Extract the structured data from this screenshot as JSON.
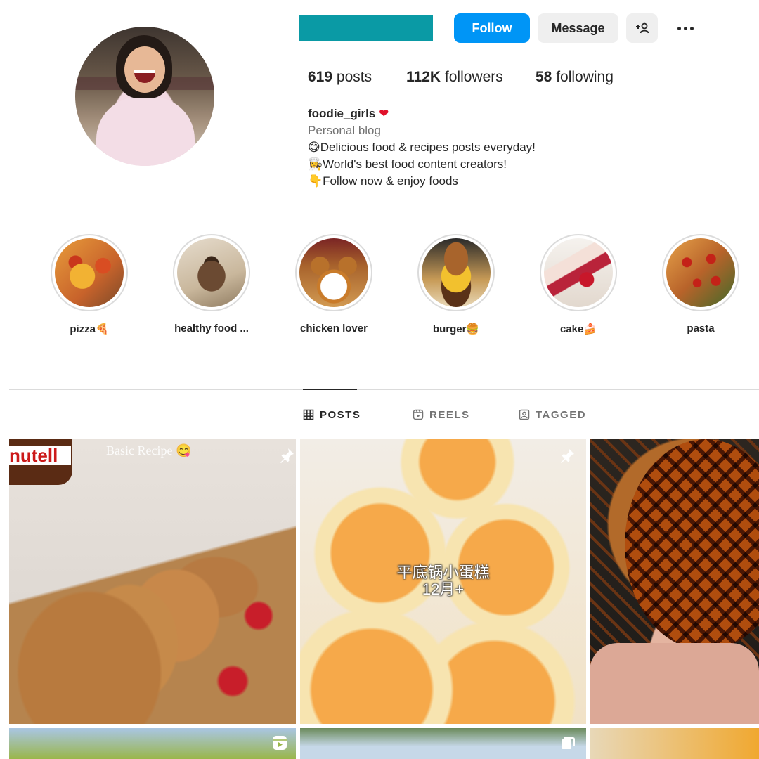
{
  "profile": {
    "username": "foodie_girls",
    "heart": "❤",
    "category": "Personal blog",
    "bio_lines": [
      "😋Delicious food & recipes posts everyday!",
      "👩‍🍳World's best food content creators!",
      "👇Follow now & enjoy foods"
    ],
    "posts_count": "619",
    "posts_label": "posts",
    "followers_count": "112K",
    "followers_label": "followers",
    "following_count": "58",
    "following_label": "following"
  },
  "actions": {
    "follow_label": "Follow",
    "message_label": "Message",
    "add_user_icon": "add-user-icon",
    "more_icon": "more-options-icon"
  },
  "highlights": [
    {
      "label": "pizza🍕"
    },
    {
      "label": "healthy food ..."
    },
    {
      "label": "chicken lover"
    },
    {
      "label": "burger🍔"
    },
    {
      "label": "cake🍰"
    },
    {
      "label": "pasta"
    }
  ],
  "tabs": [
    {
      "label": "POSTS",
      "icon": "grid-icon",
      "active": true
    },
    {
      "label": "REELS",
      "icon": "reels-icon",
      "active": false
    },
    {
      "label": "TAGGED",
      "icon": "tagged-icon",
      "active": false
    }
  ],
  "posts": {
    "p1_overlay": "Basic Recipe 😋",
    "p1_jar_text": "nutell",
    "p2_caption_line1": "平底锅小蛋糕",
    "p2_caption_line2": "12月+"
  },
  "colors": {
    "accent": "#0095f6",
    "username_block": "#0a9aa5",
    "secondary_button": "#efefef"
  }
}
